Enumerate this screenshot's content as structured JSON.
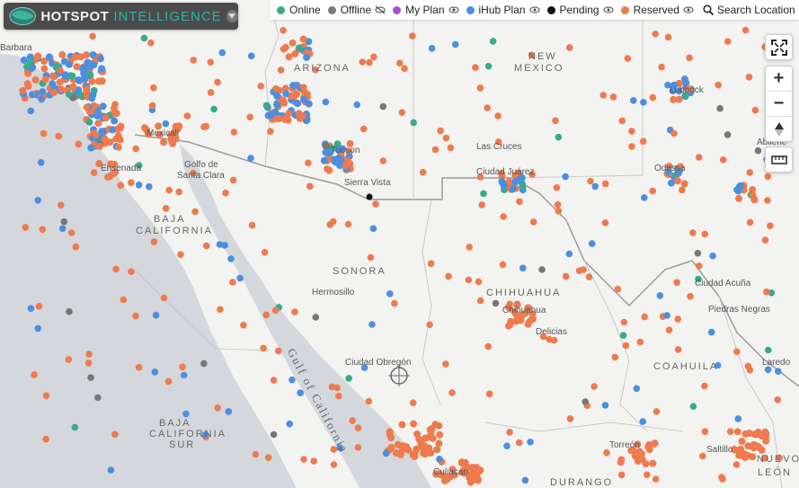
{
  "app": {
    "logo_word1": "HOTSPOT",
    "logo_word2": "INTELLIGENCE"
  },
  "legend": [
    {
      "label": "Online",
      "color": "#3aaa8c",
      "icon": "none"
    },
    {
      "label": "Offline",
      "color": "#777777",
      "icon": "eye-slash-icon"
    },
    {
      "label": "My Plan",
      "color": "#a64dd6",
      "icon": "eye-icon"
    },
    {
      "label": "iHub Plan",
      "color": "#4a8fe0",
      "icon": "eye-icon"
    },
    {
      "label": "Pending",
      "color": "#111111",
      "icon": "eye-icon"
    },
    {
      "label": "Reserved",
      "color": "#ee7a4e",
      "icon": "eye-icon"
    }
  ],
  "search": {
    "label": "Search Location",
    "icon": "search-icon"
  },
  "controls": {
    "fullscreen_icon": "fullscreen-icon",
    "zoom_in": "+",
    "zoom_out": "−",
    "compass_icon": "compass-icon",
    "ruler_icon": "ruler-icon"
  },
  "map": {
    "colors": {
      "land": "#f3f3f1",
      "water": "#d4d7db",
      "border": "#9a9a9a",
      "state": "#bdbdbd"
    },
    "labels": [
      {
        "text": "Barbara",
        "kind": "city"
      },
      {
        "text": "ARIZONA",
        "kind": "region"
      },
      {
        "text": "NEW",
        "kind": "region"
      },
      {
        "text": "MEXICO",
        "kind": "region"
      },
      {
        "text": "Lubbock",
        "kind": "city"
      },
      {
        "text": "Mexicali",
        "kind": "city"
      },
      {
        "text": "Ensenada",
        "kind": "city"
      },
      {
        "text": "Golfo de",
        "kind": "city"
      },
      {
        "text": "Santa Clara",
        "kind": "city"
      },
      {
        "text": "Tucson",
        "kind": "city"
      },
      {
        "text": "Sierra Vista",
        "kind": "city"
      },
      {
        "text": "Las Cruces",
        "kind": "city"
      },
      {
        "text": "Ciudad Juárez",
        "kind": "city"
      },
      {
        "text": "Odessa",
        "kind": "city"
      },
      {
        "text": "Abilene",
        "kind": "city"
      },
      {
        "text": "BAJA",
        "kind": "region"
      },
      {
        "text": "CALIFORNIA",
        "kind": "region"
      },
      {
        "text": "SONORA",
        "kind": "region"
      },
      {
        "text": "Hermosillo",
        "kind": "city"
      },
      {
        "text": "CHIHUAHUA",
        "kind": "region"
      },
      {
        "text": "Chihuahua",
        "kind": "city"
      },
      {
        "text": "Delicias",
        "kind": "city"
      },
      {
        "text": "Ciudad Acuña",
        "kind": "city"
      },
      {
        "text": "Piedras Negras",
        "kind": "city"
      },
      {
        "text": "Ciudad Obregón",
        "kind": "city"
      },
      {
        "text": "Gulf of California",
        "kind": "sea"
      },
      {
        "text": "COAHUILA",
        "kind": "region"
      },
      {
        "text": "Laredo",
        "kind": "city"
      },
      {
        "text": "BAJA",
        "kind": "region"
      },
      {
        "text": "CALIFORNIA",
        "kind": "region"
      },
      {
        "text": "SUR",
        "kind": "region"
      },
      {
        "text": "Culiacán",
        "kind": "city"
      },
      {
        "text": "Torreón",
        "kind": "city"
      },
      {
        "text": "Saltillo",
        "kind": "city"
      },
      {
        "text": "NUEVO",
        "kind": "region"
      },
      {
        "text": "LEÓN",
        "kind": "region"
      },
      {
        "text": "DURANGO",
        "kind": "region"
      }
    ]
  }
}
